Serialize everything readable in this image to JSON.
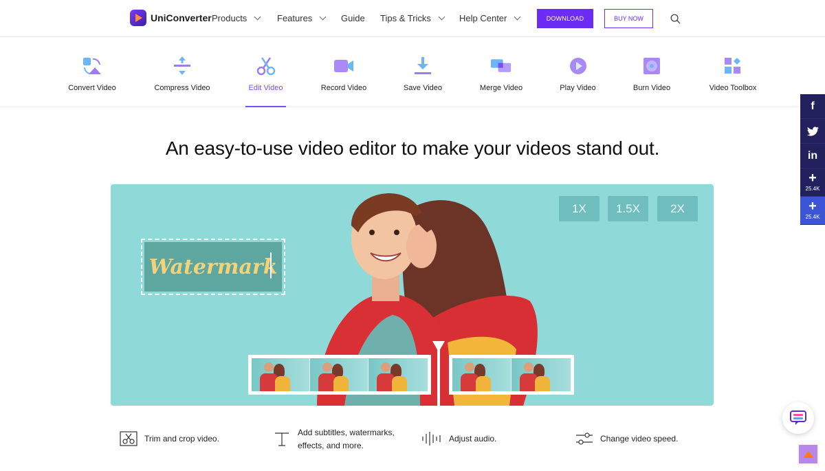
{
  "brand": {
    "name": "UniConverter"
  },
  "nav": {
    "products": "Products",
    "features": "Features",
    "guide": "Guide",
    "tips": "Tips & Tricks",
    "help": "Help Center",
    "download": "DOWNLOAD",
    "buy": "BUY NOW"
  },
  "tabs": [
    {
      "label": "Convert Video"
    },
    {
      "label": "Compress Video"
    },
    {
      "label": "Edit Video"
    },
    {
      "label": "Record Video"
    },
    {
      "label": "Save Video"
    },
    {
      "label": "Merge Video"
    },
    {
      "label": "Play Video"
    },
    {
      "label": "Burn Video"
    },
    {
      "label": "Video Toolbox"
    }
  ],
  "active_tab": "Edit Video",
  "headline": "An easy-to-use video editor to make your videos stand out.",
  "hero": {
    "watermark": "Watermark",
    "speeds": [
      "1X",
      "1.5X",
      "2X"
    ]
  },
  "features": [
    {
      "text": "Trim and crop video.",
      "icon": "scissors-icon"
    },
    {
      "text": "Add subtitles, watermarks,",
      "text2": "effects, and more.",
      "icon": "text-t-icon"
    },
    {
      "text": "Adjust audio.",
      "icon": "audio-wave-icon"
    },
    {
      "text": "Change video speed.",
      "icon": "sliders-icon"
    }
  ],
  "social": {
    "share_count": "25.4K",
    "share_count_2": "25.4K"
  },
  "colors": {
    "accent": "#6c2cf6",
    "active_tab": "#7b4cf0",
    "hero_bg": "#8fd9d8",
    "social_bg": "#22215e"
  }
}
